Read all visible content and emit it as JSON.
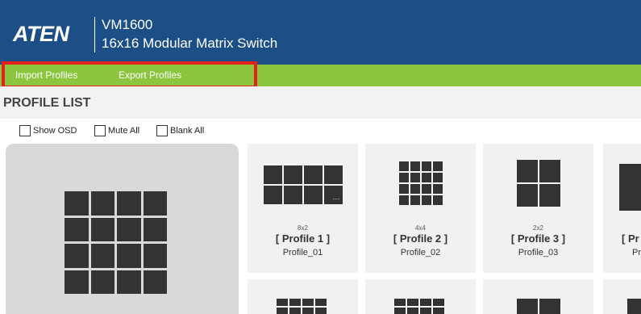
{
  "header": {
    "logo": "ATEN",
    "model": "VM1600",
    "description": "16x16 Modular Matrix Switch"
  },
  "menu": {
    "items": [
      {
        "label": "Import Profiles"
      },
      {
        "label": "Export Profiles"
      }
    ]
  },
  "profile_list": {
    "title": "PROFILE LIST",
    "options": [
      {
        "label": "Show OSD",
        "checked": false
      },
      {
        "label": "Mute All",
        "checked": false
      },
      {
        "label": "Blank All",
        "checked": false
      }
    ],
    "profiles": [
      {
        "layout": "8x2",
        "title": "[ Profile 1 ]",
        "id": "Profile_01"
      },
      {
        "layout": "4x4",
        "title": "[ Profile 2 ]",
        "id": "Profile_02"
      },
      {
        "layout": "2x2",
        "title": "[ Profile 3 ]",
        "id": "Profile_03"
      },
      {
        "layout": "",
        "title": "[ Pr",
        "id": "Pr"
      }
    ]
  },
  "colors": {
    "header": "#1b4f86",
    "menubar": "#8cc63f",
    "highlight": "#e32119",
    "tile": "#333333"
  },
  "icons": [
    "layout-grid-icon",
    "more-icon"
  ]
}
